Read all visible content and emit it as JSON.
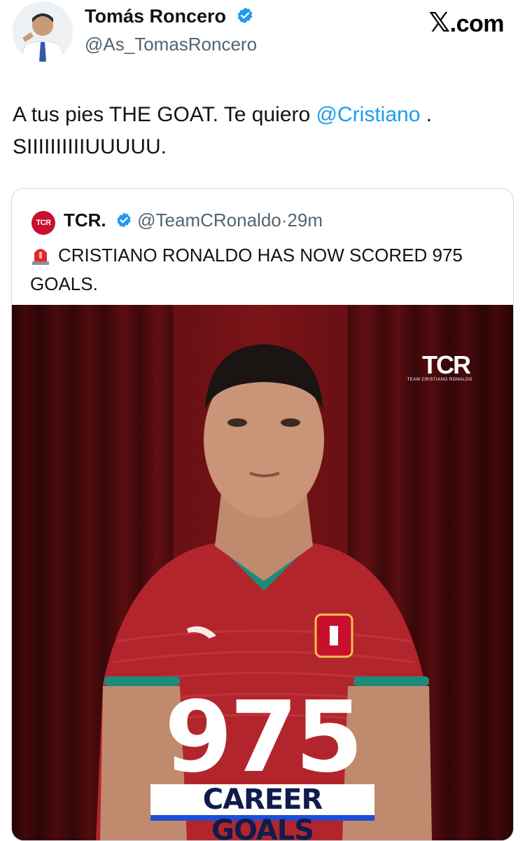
{
  "author": {
    "name": "Tomás Roncero",
    "handle": "@As_TomasRoncero",
    "verified": true
  },
  "brand": {
    "site": ".com",
    "x_glyph": "𝕏"
  },
  "tweet": {
    "text_before": "A tus pies THE GOAT. Te quiero ",
    "mention": "@Cristiano",
    "text_after": " .",
    "line2": "SIIIIIIIIIIUUUUU."
  },
  "quoted": {
    "avatar_text": "TCR",
    "name": "TCR.",
    "handle": "@TeamCRonaldo",
    "separator": "·",
    "time": "29m",
    "text": "CRISTIANO RONALDO HAS NOW SCORED 975 GOALS.",
    "image": {
      "logo": "TCR",
      "logo_sub": "TEAM CRISTIANO RONALDO",
      "number": "975",
      "caption": "CAREER GOALS"
    }
  },
  "colors": {
    "accent": "#1d9bf0",
    "verified": "#1d9bf0",
    "curtain": "#6e0d10",
    "jersey": "#b3252c",
    "trim": "#1f8a7a"
  }
}
